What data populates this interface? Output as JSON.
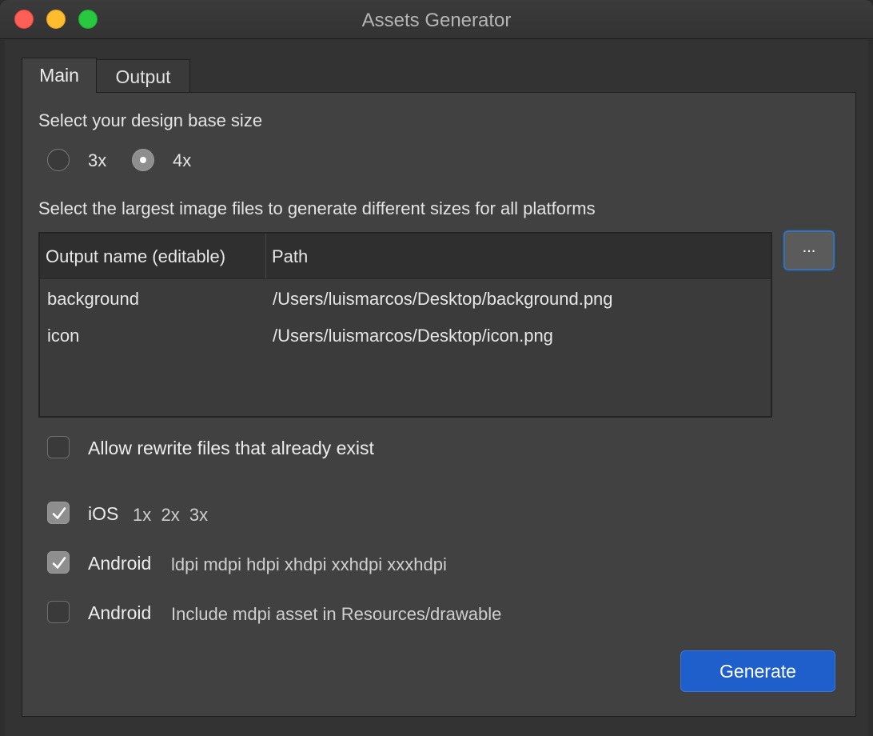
{
  "window": {
    "title": "Assets Generator"
  },
  "tabs": [
    {
      "label": "Main",
      "selected": true
    },
    {
      "label": "Output",
      "selected": false
    }
  ],
  "main": {
    "base_size_label": "Select your design base size",
    "base_size_options": [
      {
        "label": "3x",
        "selected": false
      },
      {
        "label": "4x",
        "selected": true
      }
    ],
    "files_label": "Select the largest image files to generate different sizes for all platforms",
    "table": {
      "columns": [
        "Output name (editable)",
        "Path"
      ],
      "rows": [
        {
          "name": "background",
          "path": "/Users/luismarcos/Desktop/background.png"
        },
        {
          "name": "icon",
          "path": "/Users/luismarcos/Desktop/icon.png"
        }
      ]
    },
    "browse_button_label": "...",
    "allow_rewrite": {
      "label": "Allow rewrite files that already exist",
      "checked": false
    },
    "platforms": [
      {
        "label": "iOS",
        "detail": "1x  2x  3x",
        "checked": true
      },
      {
        "label": "Android",
        "detail": "ldpi mdpi hdpi xhdpi xxhdpi xxxhdpi",
        "checked": true
      },
      {
        "label": "Android",
        "detail": "Include mdpi asset in Resources/drawable",
        "checked": false
      }
    ],
    "generate_button_label": "Generate"
  },
  "colors": {
    "accent": "#1f5fcc",
    "close": "#fe5f57",
    "minimize": "#febc2e",
    "maximize": "#28c840"
  }
}
